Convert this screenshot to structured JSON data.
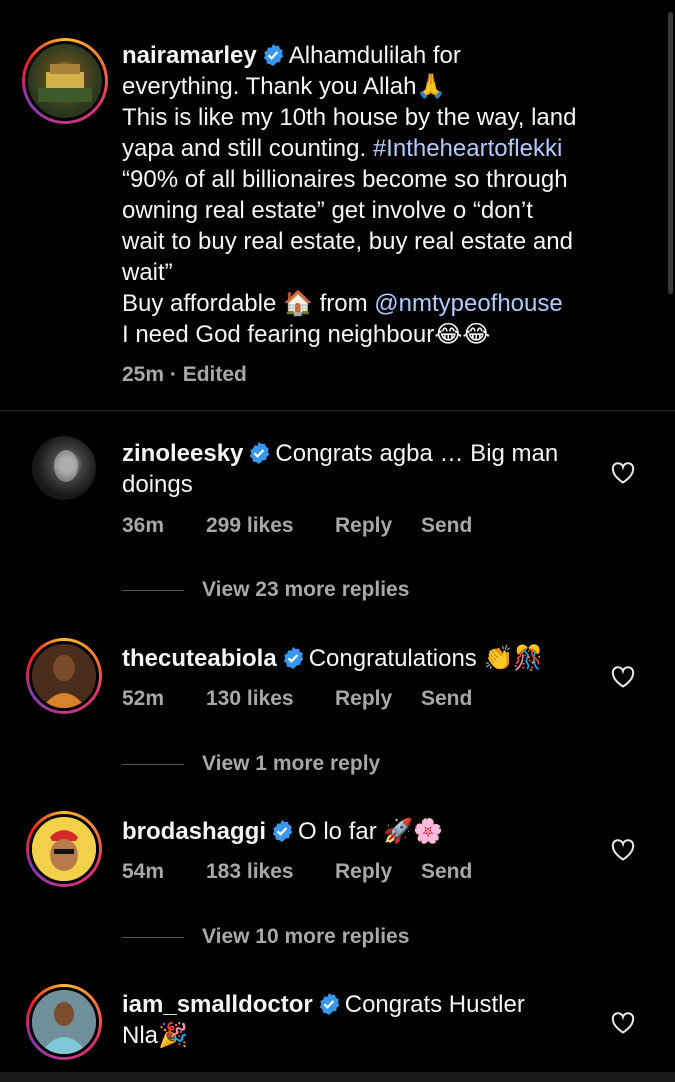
{
  "caption": {
    "username": "nairamarley",
    "lines": [
      "Alhamdulilah for",
      "everything. Thank you Allah",
      "This is like my 10th house by the way, land",
      "yapa and still counting. ",
      "#Intheheartoflekki",
      "“90% of all billionaires become so through",
      "owning real estate” get involve o “don’t",
      "wait to buy real estate, buy real estate and",
      "wait”",
      "Buy affordable ",
      " from ",
      "@nmtypeofhouse",
      "I need God fearing neighbour"
    ],
    "emoji_pray": "🙏",
    "emoji_house": "🏠",
    "emoji_laugh": "😂😂",
    "time": "25m",
    "edited": "· Edited"
  },
  "comments": [
    {
      "username": "zinoleesky",
      "text": "Congrats agba … Big man doings",
      "text_line1": "Congrats agba … Big man",
      "text_line2": "doings",
      "time": "36m",
      "likes": "299 likes",
      "reply": "Reply",
      "send": "Send",
      "view_replies": "View 23 more replies"
    },
    {
      "username": "thecuteabiola",
      "text": "Congratulations ",
      "emoji": "👏🎊",
      "time": "52m",
      "likes": "130 likes",
      "reply": "Reply",
      "send": "Send",
      "view_replies": "View 1 more reply"
    },
    {
      "username": "brodashaggi",
      "text": "O lo far ",
      "emoji": "🚀🌸",
      "time": "54m",
      "likes": "183 likes",
      "reply": "Reply",
      "send": "Send",
      "view_replies": "View 10 more replies"
    },
    {
      "username": "iam_smalldoctor",
      "text_line1": "Congrats Hustler",
      "text_line2": "Nla",
      "emoji": "🎉"
    }
  ],
  "colors": {
    "background": "#000000",
    "text": "#f5f5f5",
    "secondary": "#a8a8a8",
    "link": "#b4cbff",
    "verified": "#3897f0"
  },
  "icons": {
    "verified": "verified-badge-icon",
    "heart": "heart-outline-icon"
  }
}
